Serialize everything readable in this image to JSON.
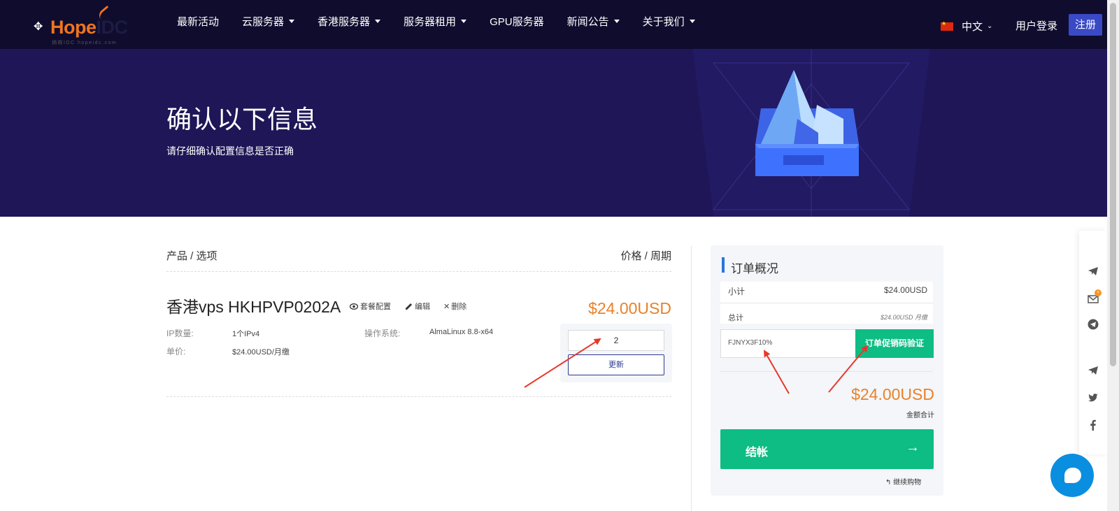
{
  "nav": {
    "logo_text_a": "Hope",
    "logo_text_b": "IDC",
    "logo_tagline": "炳辉IDC  hopeidc.com",
    "items": [
      {
        "label": "最新活动",
        "dropdown": false
      },
      {
        "label": "云服务器",
        "dropdown": true
      },
      {
        "label": "香港服务器",
        "dropdown": true
      },
      {
        "label": "服务器租用",
        "dropdown": true
      },
      {
        "label": "GPU服务器",
        "dropdown": false
      },
      {
        "label": "新闻公告",
        "dropdown": true
      },
      {
        "label": "关于我们",
        "dropdown": true
      }
    ],
    "language": "中文",
    "login": "用户登录",
    "register": "注册"
  },
  "hero": {
    "title": "确认以下信息",
    "subtitle": "请仔细确认配置信息是否正确"
  },
  "cart": {
    "header_left": "产品 / 选项",
    "header_right": "价格 / 周期",
    "product_name": "香港vps HKHPVP0202A",
    "actions": {
      "config": "套餐配置",
      "edit": "编辑",
      "delete": "删除"
    },
    "price": "$24.00USD",
    "specs": {
      "ip_label": "IP数量:",
      "ip_value": "1个IPv4",
      "os_label": "操作系统:",
      "os_value": "AlmaLinux 8.8-x64",
      "unit_label": "单价:",
      "unit_value": "$24.00USD/月缴"
    },
    "quantity": "2",
    "update_button": "更新"
  },
  "summary": {
    "title": "订单概况",
    "subtotal_label": "小计",
    "subtotal_value": "$24.00USD",
    "total_label": "总计",
    "total_value": "$24.00USD 月缴",
    "promo_code": "FJNYX3F10%",
    "promo_button": "订单促销码验证",
    "grand_total": "$24.00USD",
    "grand_total_label": "金额合计",
    "checkout": "结帐",
    "continue": "继续购物"
  },
  "float": {
    "badge": "+"
  },
  "colors": {
    "nav_bg": "#100c2e",
    "hero_bg": "#1e1657",
    "accent_orange": "#e8822a",
    "accent_green": "#0dbd83",
    "register_blue": "#3a49c5",
    "chat_blue": "#0a8ee0",
    "annotation_red": "#e8382c"
  }
}
